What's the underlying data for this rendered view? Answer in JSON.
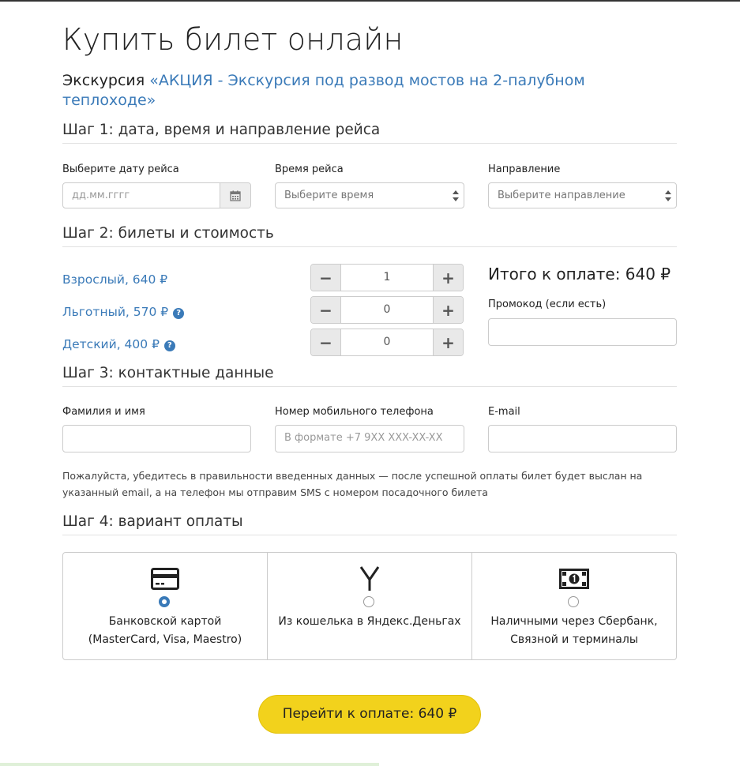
{
  "page": {
    "title": "Купить билет онлайн",
    "excursion_prefix": "Экскурсия",
    "excursion_name": "«АКЦИЯ - Экскурсия под развод мостов на 2-палубном теплоходе»"
  },
  "step1": {
    "heading": "Шаг 1: дата, время и направление рейса",
    "date_label": "Выберите дату рейса",
    "date_placeholder": "дд.мм.гггг",
    "time_label": "Время рейса",
    "time_value": "Выберите время",
    "direction_label": "Направление",
    "direction_value": "Выберите направление"
  },
  "step2": {
    "heading": "Шаг 2: билеты и стоимость",
    "tickets": [
      {
        "label": "Взрослый, 640 ₽",
        "qty": "1",
        "help": false
      },
      {
        "label": "Льготный, 570 ₽",
        "qty": "0",
        "help": true
      },
      {
        "label": "Детский, 400 ₽",
        "qty": "0",
        "help": true
      }
    ],
    "minus": "−",
    "plus": "+",
    "help_glyph": "?",
    "total": "Итого к оплате: 640 ₽",
    "promo_label": "Промокод (если есть)",
    "promo_value": ""
  },
  "step3": {
    "heading": "Шаг 3: контактные данные",
    "name_label": "Фамилия и имя",
    "name_value": "",
    "phone_label": "Номер мобильного телефона",
    "phone_placeholder": "В формате +7 9XX XXX-XX-XX",
    "email_label": "E-mail",
    "email_value": "",
    "note": "Пожалуйста, убедитесь в правильности введенных данных — после успешной оплаты билет будет выслан на указанный email, а на телефон мы отправим SMS с номером посадочного билета"
  },
  "step4": {
    "heading": "Шаг 4: вариант оплаты",
    "options": [
      {
        "line1": "Банковской картой",
        "line2": "(MasterCard, Visa, Maestro)",
        "icon": "credit-card-icon",
        "selected": true
      },
      {
        "line1": "Из кошелька в Яндекс.Деньгах",
        "line2": "",
        "icon": "yandex-money-icon",
        "selected": false
      },
      {
        "line1": "Наличными через Сбербанк,",
        "line2": "Связной и терминалы",
        "icon": "cash-icon",
        "selected": false
      }
    ]
  },
  "submit": {
    "label": "Перейти к оплате: 640 ₽"
  },
  "colors": {
    "accent": "#3a7ab8",
    "button": "#f2d21c"
  }
}
